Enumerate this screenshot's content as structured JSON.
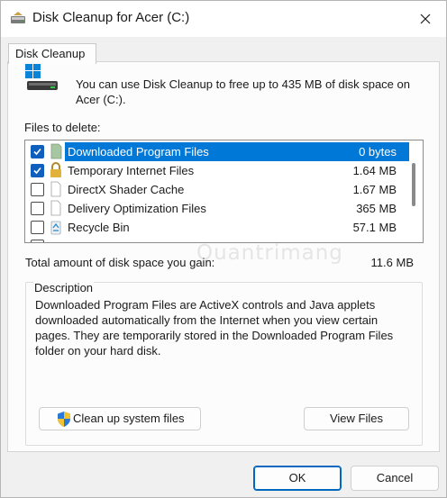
{
  "window": {
    "title": "Disk Cleanup for Acer (C:)",
    "tab_label": "Disk Cleanup"
  },
  "intro_text": "You can use Disk Cleanup to free up to 435 MB of disk space on Acer (C:).",
  "files_to_delete_label": "Files to delete:",
  "file_list": [
    {
      "name": "Downloaded Program Files",
      "size": "0 bytes",
      "checked": true,
      "selected": true,
      "icon": "folder-icon"
    },
    {
      "name": "Temporary Internet Files",
      "size": "1.64 MB",
      "checked": true,
      "selected": false,
      "icon": "lock-icon"
    },
    {
      "name": "DirectX Shader Cache",
      "size": "1.67 MB",
      "checked": false,
      "selected": false,
      "icon": "file-icon"
    },
    {
      "name": "Delivery Optimization Files",
      "size": "365 MB",
      "checked": false,
      "selected": false,
      "icon": "file-icon"
    },
    {
      "name": "Recycle Bin",
      "size": "57.1 MB",
      "checked": false,
      "selected": false,
      "icon": "recycle-bin-icon"
    }
  ],
  "total": {
    "label": "Total amount of disk space you gain:",
    "value": "11.6 MB"
  },
  "description": {
    "title": "Description",
    "text": "Downloaded Program Files are ActiveX controls and Java applets downloaded automatically from the Internet when you view certain pages. They are temporarily stored in the Downloaded Program Files folder on your hard disk."
  },
  "buttons": {
    "cleanup": "Clean up system files",
    "view_files": "View Files",
    "ok": "OK",
    "cancel": "Cancel"
  },
  "watermark": "Quantrimang",
  "colors": {
    "selection": "#0078d7",
    "checkbox_checked": "#0f5fbf",
    "ok_border": "#0067c0"
  }
}
